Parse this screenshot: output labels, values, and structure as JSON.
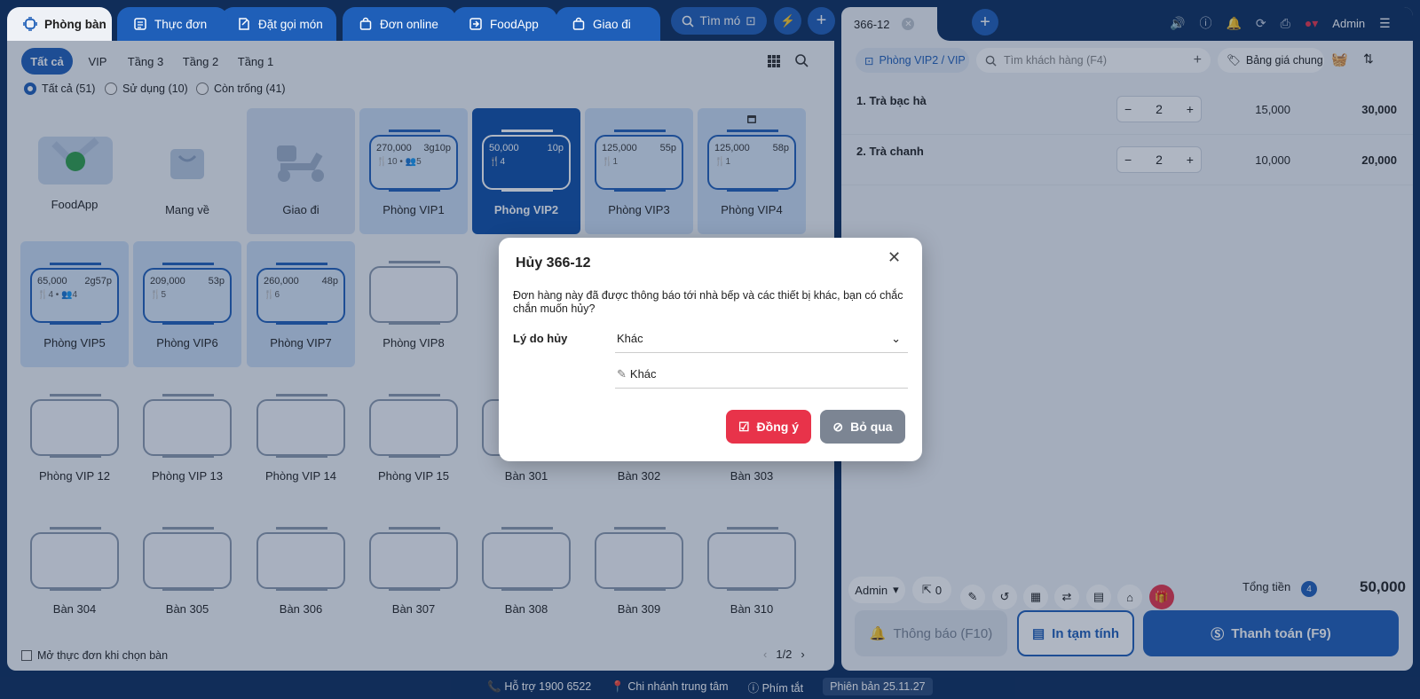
{
  "top_tabs": [
    {
      "label": "Phòng bàn",
      "icon": "table-icon"
    },
    {
      "label": "Thực đơn",
      "icon": "menu-icon"
    },
    {
      "label": "Đặt gọi món",
      "icon": "order-icon"
    },
    {
      "label": "Đơn online",
      "icon": "bag-icon"
    },
    {
      "label": "FoodApp",
      "icon": "foodapp-icon"
    },
    {
      "label": "Giao đi",
      "icon": "bag-icon"
    }
  ],
  "search_btn": "Tìm mó",
  "filter_tabs": [
    "Tất cả",
    "VIP",
    "Tầng 3",
    "Tầng 2",
    "Tầng 1"
  ],
  "radios": [
    "Tất cả (51)",
    "Sử dụng (10)",
    "Còn trống (41)"
  ],
  "tiles_row1": [
    {
      "name": "FoodApp",
      "kind": "logo"
    },
    {
      "name": "Mang về",
      "kind": "bag"
    },
    {
      "name": "Giao đi",
      "kind": "scooter"
    },
    {
      "name": "Phòng VIP1",
      "amount": "270,000",
      "time": "3g10p",
      "guests": "🍴10 • 👥5"
    },
    {
      "name": "Phòng VIP2",
      "amount": "50,000",
      "time": "10p",
      "guests": "🍴4"
    },
    {
      "name": "Phòng VIP3",
      "amount": "125,000",
      "time": "55p",
      "guests": "🍴1"
    },
    {
      "name": "Phòng VIP4",
      "amount": "125,000",
      "time": "58p",
      "guests": "🍴1"
    }
  ],
  "tiles_row2": [
    {
      "name": "Phòng VIP5",
      "amount": "65,000",
      "time": "2g57p",
      "guests": "🍴4 • 👥4"
    },
    {
      "name": "Phòng VIP6",
      "amount": "209,000",
      "time": "53p",
      "guests": "🍴5"
    },
    {
      "name": "Phòng VIP7",
      "amount": "260,000",
      "time": "48p",
      "guests": "🍴6"
    },
    {
      "name": "Phòng VIP8"
    }
  ],
  "tiles_row3": [
    "Phòng VIP 12",
    "Phòng VIP 13",
    "Phòng VIP 14",
    "Phòng VIP 15",
    "Bàn 301",
    "Bàn 302",
    "Bàn 303"
  ],
  "tiles_row4": [
    "Bàn 304",
    "Bàn 305",
    "Bàn 306",
    "Bàn 307",
    "Bàn 308",
    "Bàn 309",
    "Bàn 310"
  ],
  "open_menu_checkbox": "Mở thực đơn khi chọn bàn",
  "page": "1/2",
  "right": {
    "tab_title": "366-12",
    "user": "Admin",
    "room_chip": "Phòng VIP2 / VIP",
    "customer_placeholder": "Tìm khách hàng (F4)",
    "price_list": "Bảng giá chung",
    "items": [
      {
        "name": "1. Trà bạc hà",
        "qty": "2",
        "price": "15,000",
        "total": "30,000"
      },
      {
        "name": "2. Trà chanh",
        "qty": "2",
        "price": "10,000",
        "total": "20,000"
      }
    ],
    "staff": "Admin",
    "guest_count": "0",
    "total_label": "Tổng tiền",
    "total_count": "4",
    "total_value": "50,000",
    "notify_btn": "Thông báo (F10)",
    "print_btn": "In tạm tính",
    "pay_btn": "Thanh toán (F9)"
  },
  "status": {
    "support": "Hỗ trợ 1900 6522",
    "branch": "Chi nhánh trung tâm",
    "shortcut": "Phím tắt",
    "version": "Phiên bản 25.11.27"
  },
  "modal": {
    "title": "Hủy 366-12",
    "message": "Đơn hàng này đã được thông báo tới nhà bếp và các thiết bị khác, bạn có chắc chắn muốn hủy?",
    "reason_label": "Lý do hủy",
    "reason_value": "Khác",
    "note_value": "Khác",
    "confirm": "Đồng ý",
    "skip": "Bỏ qua"
  },
  "colors": {
    "primary": "#1f5fb8",
    "danger": "#e8334a",
    "dark": "#0c2d5e"
  }
}
